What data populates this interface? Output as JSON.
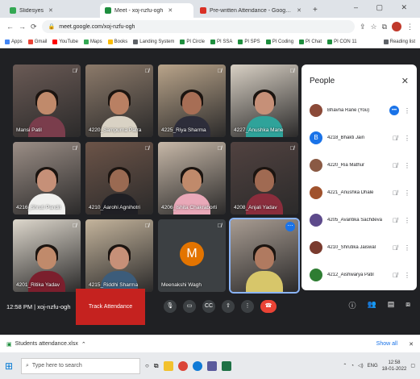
{
  "browser": {
    "tabs": [
      {
        "label": "Slidesyes",
        "color": "#34a853"
      },
      {
        "label": "Meet - xoj-nzfu-ogh",
        "color": "#1e8e3e"
      },
      {
        "label": "Pre-written Attendance - Google Sheets",
        "color": "#d93025"
      }
    ],
    "new_tab": "+",
    "url": "meet.google.com/xoj-nzfu-ogh",
    "bookmarks": [
      "Apps",
      "Gmail",
      "YouTube",
      "Maps",
      "Books",
      "Landing System",
      "PI Circle",
      "PI SSA",
      "PI SPS",
      "PI Coding",
      "PI Chat",
      "PI CON 11"
    ],
    "reading_list": "Reading list"
  },
  "meet": {
    "tiles": [
      {
        "name": "Mansi Patil",
        "skin": "#c08a6b",
        "shirt": "#7a3d4c",
        "bg": "#6a5a55"
      },
      {
        "name": "4220_Sampurna Patra",
        "skin": "#b98063",
        "shirt": "#d9d2c4",
        "bg": "#8c7a6a"
      },
      {
        "name": "4225_Riya Sharma",
        "skin": "#a76e55",
        "shirt": "#2d2d3a",
        "bg": "#b9a48a"
      },
      {
        "name": "4227_Anushka Mane",
        "skin": "#c69078",
        "shirt": "#2fa39a",
        "bg": "#d8d0c4"
      },
      {
        "name": "4216_Shruti Pandit",
        "skin": "#c69078",
        "shirt": "#f0f0ee",
        "bg": "#9b8e86"
      },
      {
        "name": "4210_Aarohi Agnihotri",
        "skin": "#9a6a52",
        "shirt": "#1f1f24",
        "bg": "#6c5448"
      },
      {
        "name": "4206_Ishita Chakraborti",
        "skin": "#c08a6b",
        "shirt": "#e9a8b8",
        "bg": "#c7b8a8"
      },
      {
        "name": "4208_Anjali Yadav",
        "skin": "#a06a52",
        "shirt": "#8a2d3c",
        "bg": "#514240"
      },
      {
        "name": "4201_Ritika Yadav",
        "skin": "#c08a6b",
        "shirt": "#7b1f2d",
        "bg": "#ddd7cc"
      },
      {
        "name": "4215_Riddhi Sharma",
        "skin": "#c69078",
        "shirt": "#3c5c7a",
        "bg": "#c4b49c"
      },
      {
        "name": "Meenakshi Wagh",
        "avatar_letter": "M"
      },
      {
        "name": "",
        "skin": "#b07a60",
        "shirt": "#d7c66a",
        "bg": "#a89c92",
        "speaking": true
      }
    ],
    "people_panel": {
      "title": "People",
      "participants": [
        {
          "name": "Bhavna Rane (You)",
          "color": "#8b4a38",
          "icon": "person"
        },
        {
          "name": "4218_Bhakti Jain",
          "color": "#1a73e8",
          "letter": "B"
        },
        {
          "name": "4220_Ria Mathur",
          "color": "#8a5a44",
          "icon": "person"
        },
        {
          "name": "4221_Anushka Dhale",
          "color": "#a0522d",
          "icon": "person"
        },
        {
          "name": "4205_Avantika Sachdeva",
          "color": "#5d4a8b",
          "icon": "person"
        },
        {
          "name": "4210_Shrutika Jaiswal",
          "color": "#7a3b2e",
          "icon": "person"
        },
        {
          "name": "4212_Aishwarya Patil",
          "color": "#2e7d32",
          "icon": "person"
        }
      ]
    },
    "meeting_info": "12:58 PM | xoj-nzfu-ogh",
    "attendance_button": "Track Attendance",
    "end_call": "call-end"
  },
  "downloads": {
    "file": "Students attendance.xlsx",
    "show_all": "Show all"
  },
  "taskbar": {
    "search_placeholder": "Type here to search",
    "time": "12:58",
    "date": "18-01-2022",
    "lang": "ENG"
  }
}
